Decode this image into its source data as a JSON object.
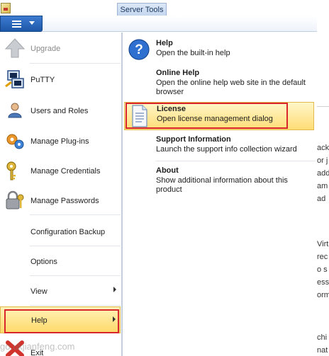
{
  "window": {
    "context_tab": "Server Tools"
  },
  "menu": {
    "items": [
      {
        "label": "Upgrade",
        "icon": "upgrade-arrow-icon"
      },
      {
        "label": "PuTTY",
        "icon": "putty-icon"
      },
      {
        "label": "Users and Roles",
        "icon": "users-icon"
      },
      {
        "label": "Manage Plug-ins",
        "icon": "plugins-icon"
      },
      {
        "label": "Manage Credentials",
        "icon": "key-icon"
      },
      {
        "label": "Manage Passwords",
        "icon": "lock-key-icon"
      },
      {
        "label": "Configuration Backup"
      },
      {
        "label": "Options"
      },
      {
        "label": "View"
      },
      {
        "label": "Help"
      },
      {
        "label": "Exit",
        "icon": "exit-icon"
      }
    ]
  },
  "submenu": {
    "items": [
      {
        "title": "Help",
        "desc": "Open the built-in help"
      },
      {
        "title": "Online Help",
        "desc": "Open the online help web site in the default browser"
      },
      {
        "title": "License",
        "desc": "Open license management dialog"
      },
      {
        "title": "Support Information",
        "desc": "Launch the support info collection wizard"
      },
      {
        "title": "About",
        "desc": "Show additional information about this product"
      }
    ]
  },
  "background": {
    "lines": [
      "ack",
      "or j",
      "add",
      "am",
      "ad",
      "Virt",
      "rec",
      "o s",
      "ess",
      "orm",
      "chi",
      "nat"
    ]
  },
  "watermark": "go.ukjianfeng.com",
  "colors": {
    "highlight": "#ffd96a",
    "annotation_red": "#d8262c",
    "file_button": "#1d57a8"
  }
}
